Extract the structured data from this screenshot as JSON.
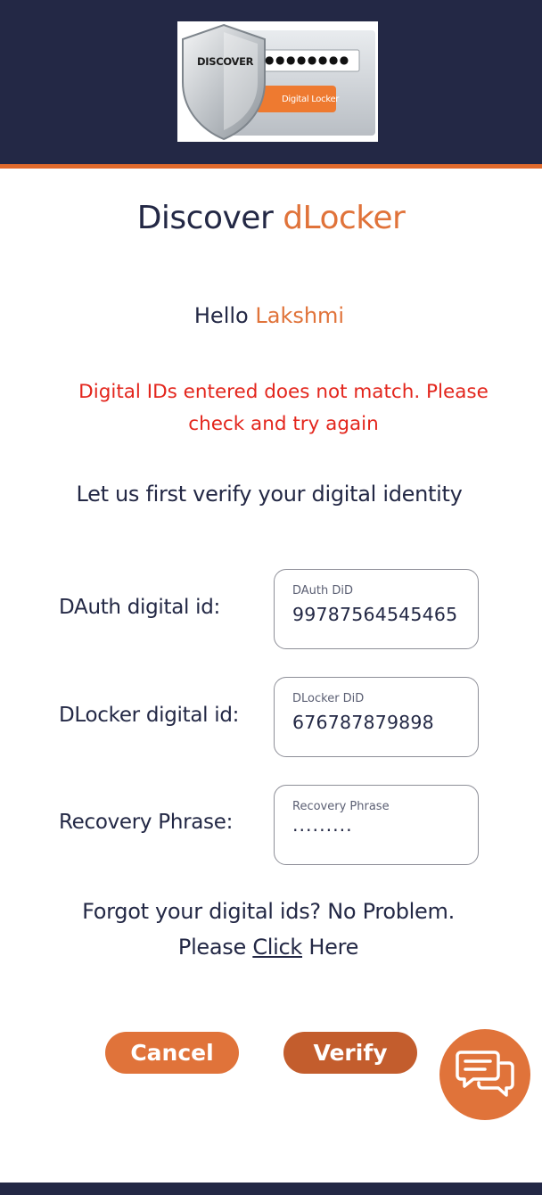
{
  "header": {
    "logo": {
      "brand": "DISCOVER",
      "password_mask": "●●●●●●●●",
      "product": "Digital Locker"
    }
  },
  "title": {
    "prefix": "Discover",
    "accent": "dLocker"
  },
  "greeting": {
    "prefix": "Hello",
    "name": "Lakshmi"
  },
  "error_message": "Digital IDs entered does not match. Please check and try again",
  "verify_heading": "Let us first verify your digital identity",
  "form": {
    "dauth": {
      "label": "DAuth digital id:",
      "field_label": "DAuth DiD",
      "value": "99787564545465"
    },
    "dlocker": {
      "label": "DLocker digital id:",
      "field_label": "DLocker DiD",
      "value": "676787879898"
    },
    "recovery": {
      "label": "Recovery Phrase:",
      "field_label": "Recovery Phrase",
      "value": "·········"
    }
  },
  "forgot": {
    "line1": "Forgot your digital ids? No Problem.",
    "prefix": "Please",
    "link": "Click",
    "suffix": "Here"
  },
  "buttons": {
    "cancel": "Cancel",
    "verify": "Verify"
  },
  "chat": {
    "icon": "chat-bubbles-icon"
  },
  "colors": {
    "navy": "#232845",
    "accent": "#e0733a",
    "verify": "#c35d2d",
    "error": "#e3261d"
  }
}
